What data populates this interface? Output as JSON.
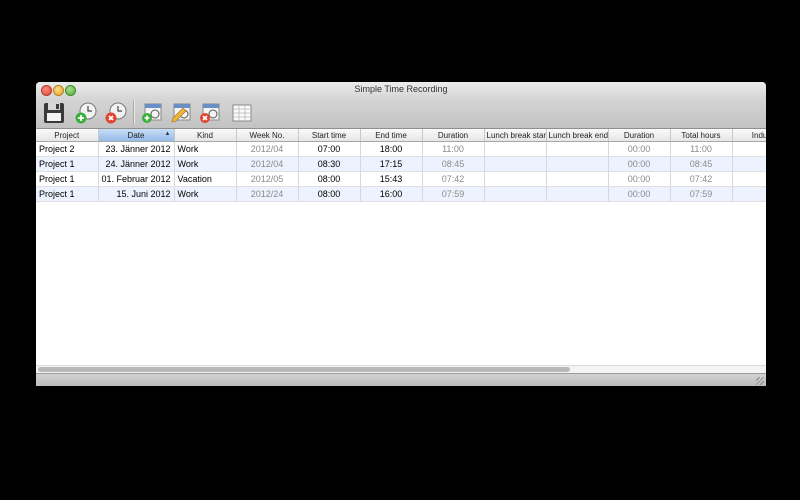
{
  "window": {
    "title": "Simple Time Recording"
  },
  "toolbar": {
    "buttons": [
      {
        "name": "save",
        "icon": "floppy-disk-icon"
      },
      {
        "name": "add-project",
        "icon": "add-clock-icon"
      },
      {
        "name": "remove-project",
        "icon": "remove-clock-icon"
      },
      {
        "name": "add-entry",
        "icon": "add-calendar-icon"
      },
      {
        "name": "edit-entry",
        "icon": "edit-calendar-icon"
      },
      {
        "name": "remove-entry",
        "icon": "remove-calendar-icon"
      },
      {
        "name": "report",
        "icon": "report-grid-icon"
      }
    ]
  },
  "table": {
    "columns": [
      "Project",
      "Date",
      "Kind",
      "Week No.",
      "Start time",
      "End time",
      "Duration",
      "Lunch break start",
      "Lunch break end",
      "Duration",
      "Total hours",
      "Industr"
    ],
    "sorted_column": "Date",
    "rows": [
      [
        "Project 2",
        "23. Jänner 2012",
        "Work",
        "2012/04",
        "07:00",
        "18:00",
        "11:00",
        "",
        "",
        "00:00",
        "11:00",
        ""
      ],
      [
        "Project 1",
        "24. Jänner 2012",
        "Work",
        "2012/04",
        "08:30",
        "17:15",
        "08:45",
        "",
        "",
        "00:00",
        "08:45",
        ""
      ],
      [
        "Project 1",
        "01. Februar 2012",
        "Vacation",
        "2012/05",
        "08:00",
        "15:43",
        "07:42",
        "",
        "",
        "00:00",
        "07:42",
        ""
      ],
      [
        "Project 1",
        "15. Juni 2012",
        "Work",
        "2012/24",
        "08:00",
        "16:00",
        "07:59",
        "",
        "",
        "00:00",
        "07:59",
        ""
      ]
    ]
  },
  "colors": {
    "selection_header": "#95bbe9",
    "alt_row": "#edf3fe",
    "background": "#000000"
  }
}
